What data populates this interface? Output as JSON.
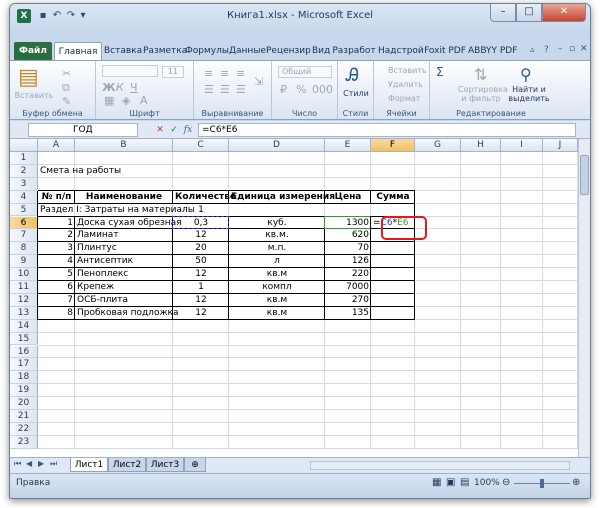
{
  "app": {
    "title": "Книга1.xlsx - Microsoft Excel",
    "icon": "X"
  },
  "window_buttons": [
    "–",
    "□",
    "✕"
  ],
  "ribbon_tabs": [
    "Файл",
    "Главная",
    "Вставка",
    "Разметка",
    "Формулы",
    "Данные",
    "Рецензир",
    "Вид",
    "Разработ",
    "Надстрой",
    "Foxit PDF",
    "ABBYY PDF"
  ],
  "ribbon": {
    "clipboard": {
      "label": "Буфер обмена",
      "paste": "Вставить"
    },
    "font": {
      "label": "Шрифт",
      "size": "11"
    },
    "alignment": {
      "label": "Выравнивание"
    },
    "number": {
      "label": "Число",
      "format": "Общий"
    },
    "styles": {
      "label": "Стили",
      "button": "Стили"
    },
    "cells": {
      "label": "Ячейки",
      "insert": "Вставить",
      "delete": "Удалить",
      "format": "Формат"
    },
    "editing": {
      "label": "Редактирование",
      "sort": "Сортировка и фильтр",
      "find": "Найти и выделить"
    }
  },
  "formula_bar": {
    "name_box": "ГОД",
    "formula": "=C6*E6",
    "cancel": "✕",
    "enter": "✓",
    "fx": "fx"
  },
  "columns": [
    "A",
    "B",
    "C",
    "D",
    "E",
    "F",
    "G",
    "H",
    "I",
    "J"
  ],
  "rows": [
    "1",
    "2",
    "3",
    "4",
    "5",
    "6",
    "7",
    "8",
    "9",
    "10",
    "11",
    "12",
    "13",
    "14",
    "15",
    "16",
    "17",
    "18",
    "19",
    "20",
    "21",
    "22",
    "23"
  ],
  "cells": {
    "title": "Смета на работы",
    "headers": [
      "№ п/п",
      "Наименование",
      "Количество",
      "Единица измерения",
      "Цена",
      "Сумма"
    ],
    "section": "Раздел I: Затраты на материалы",
    "items": [
      {
        "n": "1",
        "name": "Доска сухая обрезная",
        "qty": "0,3",
        "unit": "куб.",
        "price": "1300",
        "sum": "=C6*E6"
      },
      {
        "n": "2",
        "name": "Ламинат",
        "qty": "12",
        "unit": "кв.м.",
        "price": "620",
        "sum": ""
      },
      {
        "n": "3",
        "name": "Плинтус",
        "qty": "20",
        "unit": "м.п.",
        "price": "70",
        "sum": ""
      },
      {
        "n": "4",
        "name": "Антисептик",
        "qty": "50",
        "unit": "л",
        "price": "126",
        "sum": ""
      },
      {
        "n": "5",
        "name": "Пеноплекс",
        "qty": "12",
        "unit": "кв.м",
        "price": "220",
        "sum": ""
      },
      {
        "n": "6",
        "name": "Крепеж",
        "qty": "1",
        "unit": "компл",
        "price": "7000",
        "sum": ""
      },
      {
        "n": "7",
        "name": "ОСБ-плита",
        "qty": "12",
        "unit": "кв.м",
        "price": "270",
        "sum": ""
      },
      {
        "n": "8",
        "name": "Пробковая подложка",
        "qty": "12",
        "unit": "кв.м",
        "price": "135",
        "sum": ""
      }
    ],
    "row5_qty": "1"
  },
  "sheets": [
    "Лист1",
    "Лист2",
    "Лист3"
  ],
  "status": {
    "mode": "Правка",
    "zoom": "100%"
  },
  "colors": {
    "highlight": "#e01a1a",
    "ref_c6": "#2a3fd6",
    "ref_e6": "#2f9a2f"
  }
}
